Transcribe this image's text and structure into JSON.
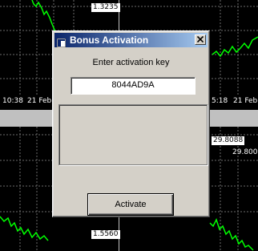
{
  "background": {
    "chart_labels": {
      "price_top": "1.3235",
      "time_left_1": "10:38",
      "time_left_2": "21 Feb",
      "time_right": "5:18",
      "date_right": "21 Feb",
      "price_right": "29.8088",
      "price_right_2": "29.800",
      "price_bottom": "1.5560"
    }
  },
  "dialog": {
    "title": "Bonus Activation",
    "prompt": "Enter activation key",
    "key_value": "8044AD9A",
    "message": "",
    "activate_label": "Activate"
  },
  "colors": {
    "titlebar_start": "#0a246a",
    "titlebar_end": "#a6caf0",
    "dialog_face": "#d4d0c8",
    "chart_line": "#00ff00"
  }
}
